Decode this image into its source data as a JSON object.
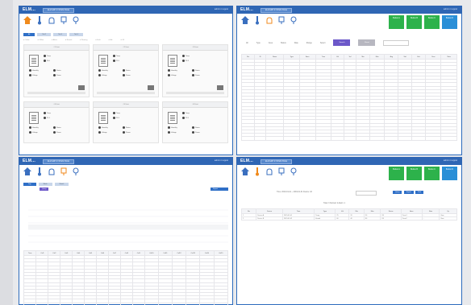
{
  "app": {
    "logo": "ELM...",
    "header_button": "ELM ERP SYSTEM PAGE",
    "header_right": "admin  ▾  Logout"
  },
  "nav_icons": [
    {
      "name": "home-icon",
      "label": "Home",
      "color": "#f08a1c"
    },
    {
      "name": "thermometer-icon",
      "label": "Monitor",
      "color": "#3a6fbf"
    },
    {
      "name": "hand-icon",
      "label": "Control",
      "color": "#3a6fbf"
    },
    {
      "name": "tank-icon",
      "label": "Devices",
      "color": "#3a6fbf"
    },
    {
      "name": "pin-icon",
      "label": "Location",
      "color": "#3a6fbf"
    }
  ],
  "panel1": {
    "tabs": [
      "All",
      "Tab 2",
      "Tab 3",
      "Tab 4"
    ],
    "legend": [
      "● Online",
      "● Offline",
      "● Alarm",
      "● Normal",
      "● Warning",
      "● Fault",
      "● Idle",
      "● Off"
    ],
    "cards": [
      {
        "title": "#1 Unit",
        "lines": [
          "Temp",
          "26.0",
          "Humidity",
          "Status",
          "Voltage",
          "Power"
        ]
      },
      {
        "title": "#2 Unit",
        "lines": [
          "Temp",
          "25.5",
          "Humidity",
          "Status",
          "Voltage",
          "Power"
        ]
      },
      {
        "title": "#3 Unit",
        "lines": [
          "Temp",
          "24.8",
          "Humidity",
          "Status",
          "Voltage",
          "Power"
        ]
      },
      {
        "title": "#4 Unit",
        "lines": [
          "Temp",
          "25.1",
          "Humidity",
          "Status",
          "Voltage",
          "Power"
        ]
      },
      {
        "title": "#5 Unit",
        "lines": [
          "Temp",
          "26.3",
          "Humidity",
          "Status",
          "Voltage",
          "Power"
        ]
      },
      {
        "title": "#6 Unit",
        "lines": [
          "Temp",
          "25.9",
          "Humidity",
          "Status",
          "Voltage",
          "Power"
        ]
      }
    ]
  },
  "panel2": {
    "green_buttons": [
      "Button A",
      "Button B",
      "Button C",
      "Button D"
    ],
    "filters": [
      "All",
      "Type",
      "Area",
      "Status",
      "Date",
      "Range",
      "Select"
    ],
    "search_btn": "Search",
    "reset_btn": "Reset",
    "columns": [
      "No.",
      "ID",
      "Name",
      "Type",
      "Area",
      "Time",
      "Val",
      "Val",
      "Min",
      "Max",
      "Avg",
      "Std",
      "Unit",
      "Sum",
      "Note"
    ],
    "rows": 24
  },
  "panel3": {
    "tabs": [
      "Day",
      "Week",
      "Month"
    ],
    "buttons": [
      "Query",
      "Export"
    ],
    "columns": [
      "Time",
      "Col1",
      "Col2",
      "Col3",
      "Col4",
      "Col5",
      "Col6",
      "Col7",
      "Col8",
      "Col9",
      "Col10",
      "Col11",
      "Col12",
      "Col13",
      "Col14",
      "Col15"
    ],
    "rows": 16
  },
  "panel4": {
    "green_buttons": [
      "Button A",
      "Button B",
      "Button C",
      "Button D"
    ],
    "filter_text": "Time: 2019-01-01 ~ 2019-01-31  Device: All",
    "buttons": [
      "Query",
      "Export",
      "Print"
    ],
    "summary": "Total: 3   Normal: 2   Alarm: 1",
    "columns": [
      "No.",
      "Device",
      "Time",
      "Type",
      "Val",
      "Min",
      "Max",
      "Status",
      "Area",
      "Note",
      "Op"
    ],
    "rows": [
      [
        "1",
        "Device A",
        "2019-01-01",
        "Temp",
        "25",
        "20",
        "30",
        "OK",
        "Zone1",
        "-",
        "View"
      ],
      [
        "2",
        "Device B",
        "2019-01-02",
        "Humid",
        "60",
        "40",
        "80",
        "OK",
        "Zone2",
        "-",
        "View"
      ]
    ]
  }
}
